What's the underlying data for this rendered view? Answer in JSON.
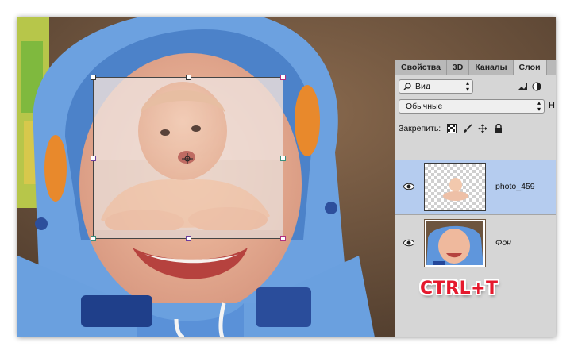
{
  "panel": {
    "tabs": [
      {
        "label": "Свойства"
      },
      {
        "label": "3D"
      },
      {
        "label": "Каналы"
      },
      {
        "label": "Слои"
      }
    ],
    "filter": {
      "value": "Вид"
    },
    "blend_mode": {
      "value": "Обычные"
    },
    "opacity_cut": "Н",
    "lock_label": "Закрепить:",
    "layers": [
      {
        "name": "photo_459",
        "selected": true,
        "visible": true
      },
      {
        "name": "Фон",
        "selected": false,
        "visible": true
      }
    ]
  },
  "overlay": {
    "shortcut": "CTRL+T"
  },
  "colors": {
    "accent": "#e5192d",
    "selected_layer": "#b5ccef",
    "panel_bg": "#d6d6d6"
  },
  "icons": [
    "search-icon",
    "image-filter-icon",
    "circle-half-icon",
    "lock-pixels-icon",
    "brush-icon",
    "move-icon",
    "lock-icon",
    "eye-icon"
  ]
}
